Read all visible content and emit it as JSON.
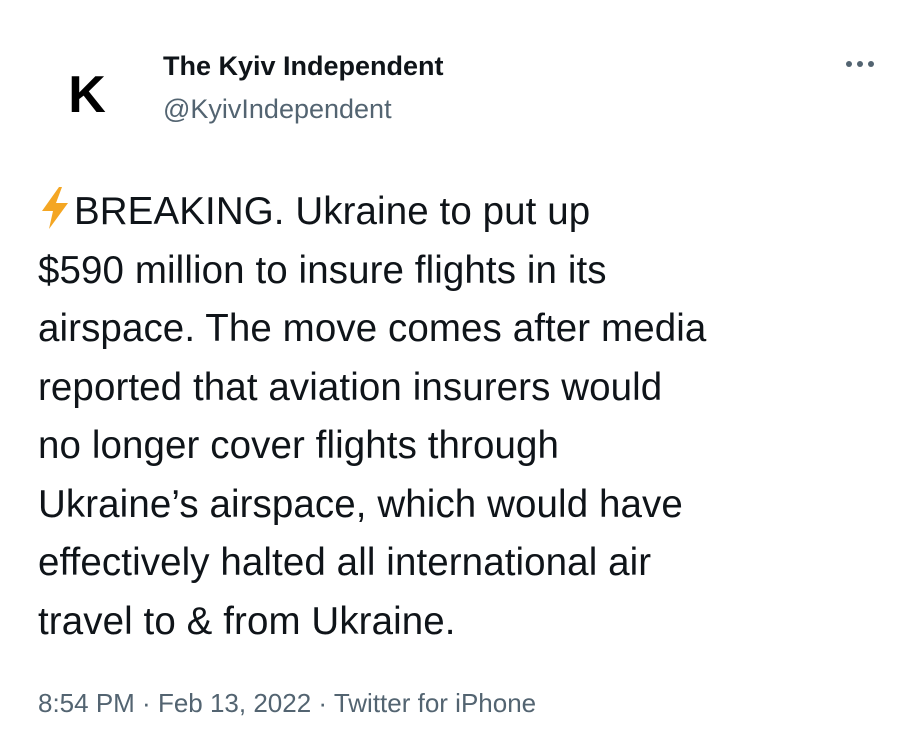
{
  "author": {
    "avatar_letter": "K",
    "display_name": "The Kyiv Independent",
    "handle": "@KyivIndependent"
  },
  "more_icon": "more-horizontal-icon",
  "tweet": {
    "emoji": "high-voltage-icon",
    "lines": [
      "BREAKING. Ukraine to put up",
      "$590 million to insure flights in its",
      "airspace. The move comes after media",
      "reported that aviation insurers would",
      "no longer cover flights through",
      "Ukraine’s airspace, which would have",
      "effectively halted all international air",
      "travel to & from Ukraine."
    ]
  },
  "meta": {
    "time": "8:54 PM",
    "sep1": " · ",
    "date": "Feb 13, 2022",
    "sep2": " · ",
    "source": "Twitter for iPhone"
  },
  "colors": {
    "text_primary": "#0f1419",
    "text_secondary": "#536471",
    "bolt": "#f4a623"
  }
}
